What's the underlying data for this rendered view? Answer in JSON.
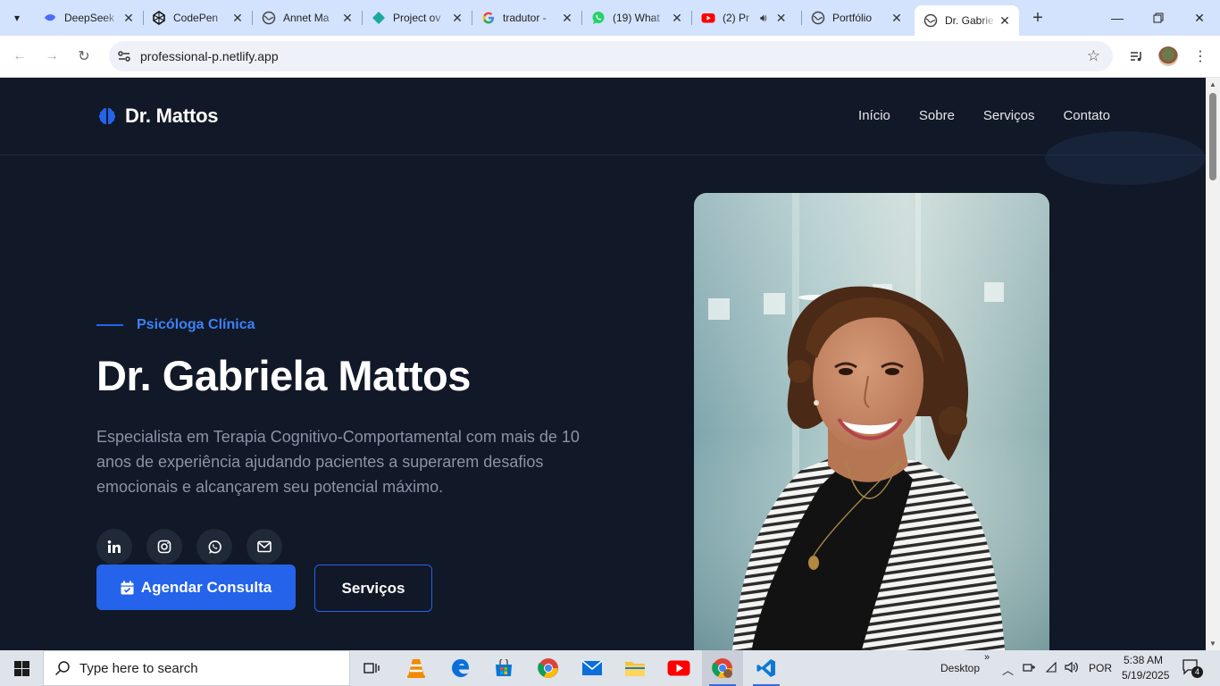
{
  "browser": {
    "tabs": [
      {
        "title": "DeepSeek",
        "icon": "deepseek-icon"
      },
      {
        "title": "CodePen",
        "icon": "codepen-icon"
      },
      {
        "title": "Annet Ma",
        "icon": "globe-icon"
      },
      {
        "title": "Project ov",
        "icon": "diamond-icon"
      },
      {
        "title": "tradutor -",
        "icon": "google-icon"
      },
      {
        "title": "(19) What",
        "icon": "whatsapp-icon"
      },
      {
        "title": "(2) Pr",
        "icon": "youtube-icon"
      },
      {
        "title": "Portfólio",
        "icon": "globe-icon"
      },
      {
        "title": "Dr. Gabrie",
        "icon": "globe-icon",
        "active": true
      }
    ],
    "url": "professional-p.netlify.app"
  },
  "site": {
    "logo_text": "Dr. Mattos",
    "nav": [
      "Início",
      "Sobre",
      "Serviços",
      "Contato"
    ],
    "eyebrow": "Psicóloga Clínica",
    "title": "Dr. Gabriela Mattos",
    "description": "Especialista em Terapia Cognitivo-Comportamental com mais de 10 anos de experiência ajudando pacientes a superarem desafios emocionais e alcançarem seu potencial máximo.",
    "socials": [
      "linkedin-icon",
      "instagram-icon",
      "whatsapp-icon",
      "mail-icon"
    ],
    "cta_primary": "Agendar Consulta",
    "cta_secondary": "Serviços",
    "accent": "#2563eb",
    "background": "#111827"
  },
  "taskbar": {
    "search_placeholder": "Type here to search",
    "desktop_label": "Desktop",
    "language": "POR",
    "time": "5:38 AM",
    "date": "5/19/2025",
    "notifications": "4"
  }
}
